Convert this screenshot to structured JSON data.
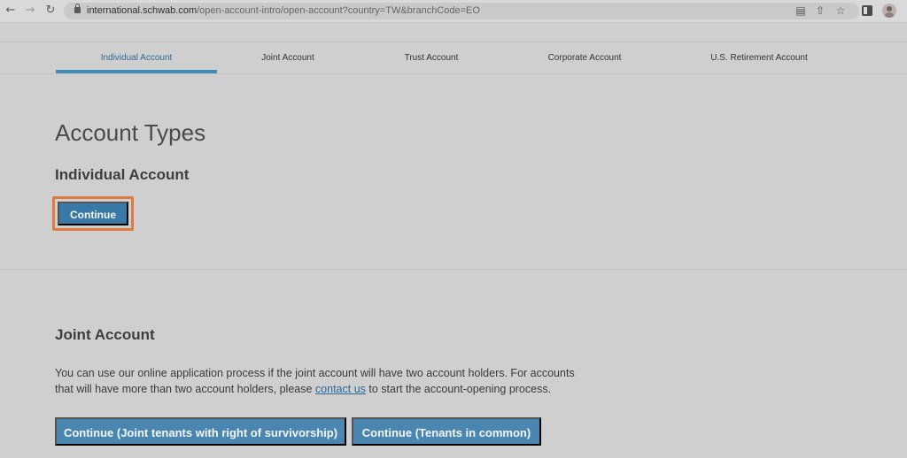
{
  "browser": {
    "url_host": "international.schwab.com",
    "url_path": "/open-account-intro/open-account?country=TW&branchCode=EO",
    "icons": [
      "back-arrow-icon",
      "forward-arrow-icon",
      "reload-icon",
      "lock-icon",
      "translate-icon",
      "share-icon",
      "star-icon",
      "side-panel-icon",
      "profile-avatar"
    ]
  },
  "tabs": [
    {
      "label": "Individual Account",
      "active": true
    },
    {
      "label": "Joint Account",
      "active": false
    },
    {
      "label": "Trust Account",
      "active": false
    },
    {
      "label": "Corporate Account",
      "active": false
    },
    {
      "label": "U.S. Retirement Account",
      "active": false
    }
  ],
  "main": {
    "title": "Account Types",
    "individual": {
      "heading": "Individual Account",
      "continue_label": "Continue"
    },
    "joint": {
      "heading": "Joint Account",
      "desc_part1": "You can use our online application process if the joint account will have two account holders. For accounts that will have more than two account holders, please ",
      "link_text": "contact us",
      "desc_part2": " to start the account-opening process.",
      "btn_joint_tenants": "Continue (Joint tenants with right of survivorship)",
      "btn_tenants_common": "Continue (Tenants in common)"
    }
  },
  "colors": {
    "accent": "#3879a6",
    "highlight": "#e07b3f",
    "tab_active": "#3f8cb9"
  }
}
